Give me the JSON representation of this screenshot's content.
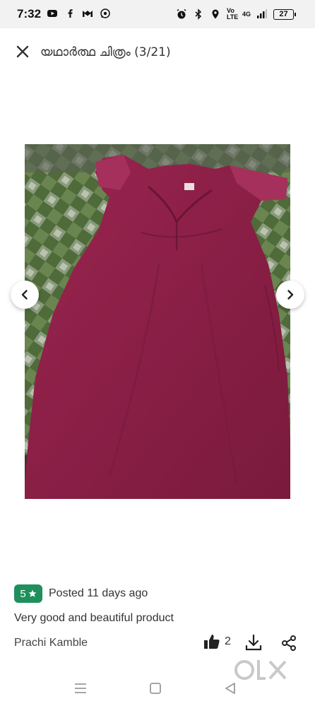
{
  "status_bar": {
    "time": "7:32",
    "network_text": "Vo LTE",
    "signal_text": "4G",
    "battery_level": "27",
    "left_icons": [
      "youtube-icon",
      "facebook-icon",
      "gmail-icon",
      "whatsapp-icon"
    ],
    "right_icons": [
      "alarm-icon",
      "bluetooth-icon",
      "location-icon",
      "signal-icon",
      "battery-icon"
    ]
  },
  "header": {
    "title": "യഥാർത്ഥ ചിത്രം (3/21)",
    "close_icon": "close-icon"
  },
  "gallery": {
    "prev_icon": "chevron-left-icon",
    "next_icon": "chevron-right-icon",
    "image_subject": "maroon dress photo"
  },
  "review": {
    "rating": "5",
    "rating_icon": "star-icon",
    "posted": "Posted 11 days ago",
    "text": "Very good and beautiful product",
    "author": "Prachi Kamble",
    "likes": "2",
    "actions": [
      "thumbs-up-icon",
      "download-icon",
      "share-icon"
    ]
  },
  "watermark": "olx",
  "colors": {
    "rating_badge": "#1f8f5b",
    "dress": "#8e1f44"
  }
}
